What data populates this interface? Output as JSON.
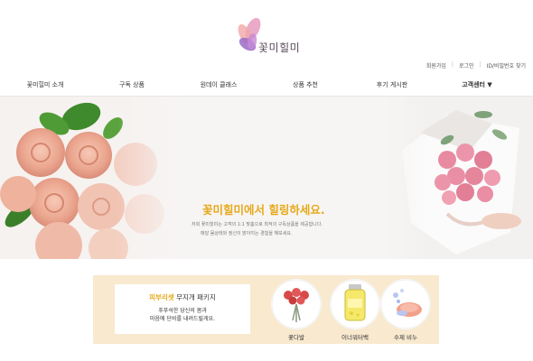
{
  "logo": {
    "text": "꽃미힐미"
  },
  "util_links": [
    "회원가입",
    "로그인",
    "ID/비밀번호 찾기"
  ],
  "nav": {
    "items": [
      "꽃미힐미 소개",
      "구독 상품",
      "원데이 클래스",
      "상품 추천",
      "후기 게시판",
      "고객센터 ▼"
    ]
  },
  "hero": {
    "title": "꽃미힐미에서 힐링하세요.",
    "line1": "저희 꽃미힐미는 고객의 1:1 맞춤으로 최적의 구독상품을 제공합니다.",
    "line2": "매달 몸상태와 정신이 맑아지는 경험을 해보세요."
  },
  "promo": {
    "title_highlight": "피부리셋",
    "title_rest": " 무지개 패키지",
    "desc_line1": "푸푸석한 당신의 몸과",
    "desc_line2": "마음에 단비를 내려드릴게요.",
    "products": [
      "꽃다발",
      "이너워터백",
      "수제 비누"
    ]
  },
  "colors": {
    "accent": "#e6a91b",
    "promo_bg": "#f8e9cf"
  }
}
